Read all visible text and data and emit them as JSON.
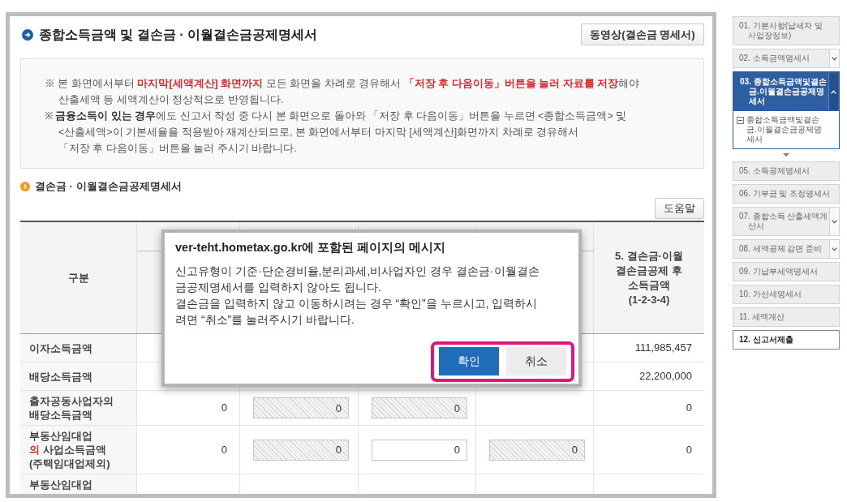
{
  "page": {
    "title": "종합소득금액 및 결손금 · 이월결손금공제명세서",
    "video_button": "동영상(결손금 명세서)"
  },
  "notice": [
    {
      "segments": [
        {
          "text": "※ 본 화면에서부터 ",
          "kind": "plain"
        },
        {
          "text": "마지막[세액계산] 화면까지",
          "kind": "alert"
        },
        {
          "text": " 모든 화면을 차례로 경유해서 ",
          "kind": "plain"
        },
        {
          "text": "「저장 후 다음이동」버튼을 눌러 자료를 저장",
          "kind": "alert"
        },
        {
          "text": "해야 산출세액 등 세액계산이 정상적으로 반영됩니다.",
          "kind": "plain"
        }
      ]
    },
    {
      "segments": [
        {
          "text": "※ ",
          "kind": "plain"
        },
        {
          "text": "금융소득이 있는 경우",
          "kind": "bold"
        },
        {
          "text": "에도 신고서 작성 중 다시 본 화면으로 돌아와 「저장 후 다음이동」버튼을 누르면 <종합소득금액> 및\n<산출세액>이 기본세율을 적용받아 재계산되므로, 본 화면에서부터 마지막 [세액계산]화면까지 차례로 경유해서\n「저장 후 다음이동」버튼을 눌러 주시기 바랍니다.",
          "kind": "plain"
        }
      ]
    }
  ],
  "section": {
    "title": "결손금 · 이월결손금공제명세서",
    "help_button": "도움말"
  },
  "table": {
    "header_first": "구분",
    "header_last": "5. 결손금·이월결손금공제 후 소득금액\n(1-2-3-4)",
    "rows": [
      {
        "label": [
          {
            "text": "이자소득금액",
            "kind": "plain"
          }
        ],
        "column_6": {
          "kind": "text",
          "value": "111,985,457"
        }
      },
      {
        "label": [
          {
            "text": "배당소득금액",
            "kind": "plain"
          }
        ],
        "column_6": {
          "kind": "text",
          "value": "22,200,000"
        }
      },
      {
        "label": [
          {
            "text": "출자공동사업자의 배당소득금액",
            "kind": "plain"
          }
        ],
        "column_2": {
          "kind": "text",
          "value": "0"
        },
        "column_3": {
          "kind": "input",
          "value": "0",
          "disabled": true
        },
        "column_4": {
          "kind": "input",
          "value": "0",
          "disabled": true
        },
        "column_6": {
          "kind": "text",
          "value": "0"
        }
      },
      {
        "label": [
          {
            "text": "부동산임대업\n",
            "kind": "plain"
          },
          {
            "text": "의",
            "kind": "alert"
          },
          {
            "text": " 사업소득금액\n(주택임대업제외)",
            "kind": "plain"
          }
        ],
        "column_2": {
          "kind": "text",
          "value": "0"
        },
        "column_3": {
          "kind": "input",
          "value": "0",
          "disabled": true
        },
        "column_4": {
          "kind": "input",
          "value": "0",
          "disabled": false
        },
        "column_5": {
          "kind": "input",
          "value": "0",
          "disabled": true
        },
        "column_6": {
          "kind": "text",
          "value": "0"
        }
      },
      {
        "label": [
          {
            "text": "부동산임대업",
            "kind": "plain"
          }
        ]
      }
    ]
  },
  "dialog": {
    "title": "ver-teht.hometax.go.kr에 포함된 페이지의 메시지",
    "message": [
      "신고유형이 기준·단순경비율,분리과세,비사업자인 경우 결손금·이월결손금공제명세서를 입력하지 않아도 됩니다.",
      "결손금을 입력하지 않고 이동하시려는 경우 “확인”을 누르시고, 입력하시려면 “취소”를 눌러주시기 바랍니다."
    ],
    "buttons": [
      {
        "label": "확인",
        "kind": "primary"
      },
      {
        "label": "취소",
        "kind": "secondary"
      }
    ],
    "buttons_highlighted": true
  },
  "sidebar": {
    "items": [
      {
        "label": "01. 기본사항(납세자 및 사업장정보)",
        "selected": false,
        "emphasized": false
      },
      {
        "label": "02. 소득금액명세서",
        "selected": false,
        "emphasized": false,
        "expanded": false
      },
      {
        "label": "03. 종합소득금액및결손금.이월결손금공제명세서",
        "selected": true,
        "emphasized": false,
        "expanded": true,
        "children": [
          {
            "label": "종합소득금액및결손금.이월결손금공제명세서"
          }
        ]
      },
      {
        "label": "05. 소득공제명세서",
        "selected": false,
        "emphasized": false
      },
      {
        "label": "06. 기부금 및 조정명세서",
        "selected": false,
        "emphasized": false
      },
      {
        "label": "07. 종합소득 산출세액계산서",
        "selected": false,
        "emphasized": false,
        "expanded": false
      },
      {
        "label": "08. 세액공제 감면 준비",
        "selected": false,
        "emphasized": false,
        "expanded": false
      },
      {
        "label": "09. 기납부세액명세서",
        "selected": false,
        "emphasized": false
      },
      {
        "label": "10. 가산세명세서",
        "selected": false,
        "emphasized": false
      },
      {
        "label": "11. 세액계산",
        "selected": false,
        "emphasized": false
      },
      {
        "label": "12. 신고서제출",
        "selected": false,
        "emphasized": true
      }
    ]
  }
}
